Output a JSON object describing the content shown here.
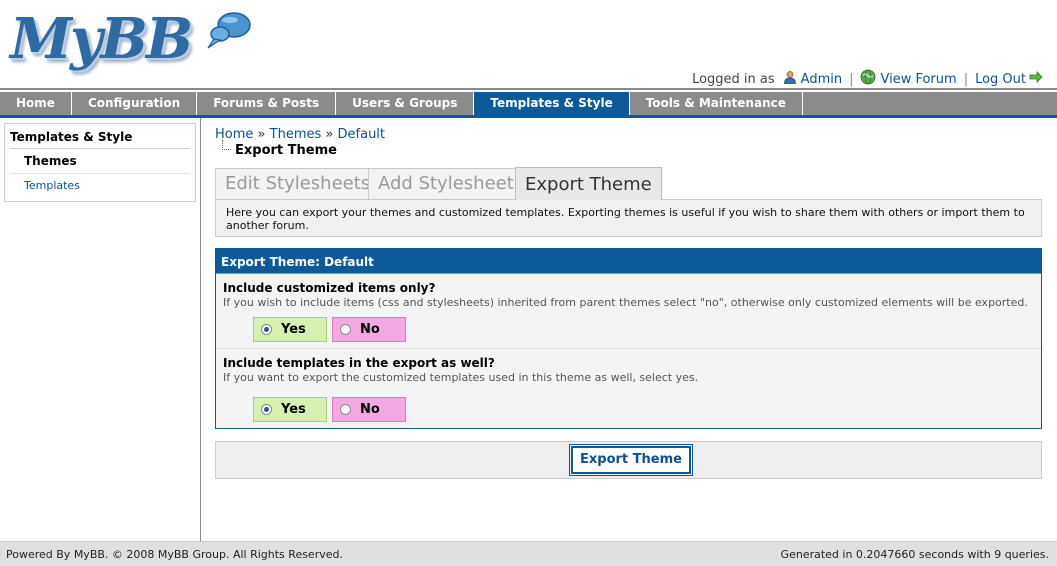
{
  "header": {
    "logo_text": "MyBB",
    "logged_in_as": "Logged in as",
    "admin_label": "Admin",
    "view_forum_label": "View Forum",
    "logout_label": "Log Out",
    "icons": [
      "user-icon",
      "globe-icon",
      "arrow-right-icon"
    ]
  },
  "menu": [
    "Home",
    "Configuration",
    "Forums & Posts",
    "Users & Groups",
    "Templates & Style",
    "Tools & Maintenance"
  ],
  "menu_active": "Templates & Style",
  "sidebar": {
    "title": "Templates & Style",
    "items": [
      {
        "label": "Themes",
        "active": true
      },
      {
        "label": "Templates",
        "active": false
      }
    ]
  },
  "breadcrumb": {
    "home": "Home",
    "themes": "Themes",
    "default": "Default",
    "separator": "»",
    "current": "Export Theme"
  },
  "tabs": [
    {
      "label": "Edit Stylesheets",
      "active": false
    },
    {
      "label": "Add Stylesheet",
      "active": false
    },
    {
      "label": "Export Theme",
      "active": true
    }
  ],
  "tab_description": "Here you can export your themes and customized templates. Exporting themes is useful if you wish to share them with others or import them to another forum.",
  "panel": {
    "title": "Export Theme: Default",
    "rows": [
      {
        "title": "Include customized items only?",
        "description": "If you wish to include items (css and stylesheets) inherited from parent themes select \"no\", otherwise only customized elements will be exported.",
        "yes_label": "Yes",
        "no_label": "No",
        "selected": "yes"
      },
      {
        "title": "Include templates in the export as well?",
        "description": "If you want to export the customized templates used in this theme as well, select yes.",
        "yes_label": "Yes",
        "no_label": "No",
        "selected": "yes"
      }
    ]
  },
  "submit_label": "Export Theme",
  "footer": {
    "left": "Powered By MyBB. © 2008 MyBB Group. All Rights Reserved.",
    "right": "Generated in 0.2047660 seconds with 9 queries."
  },
  "colors": {
    "brand_blue": "#0e5a98",
    "menu_gray": "#8b8b8b",
    "yes_bg": "#d6f0b0",
    "no_bg": "#f2a8e0"
  }
}
